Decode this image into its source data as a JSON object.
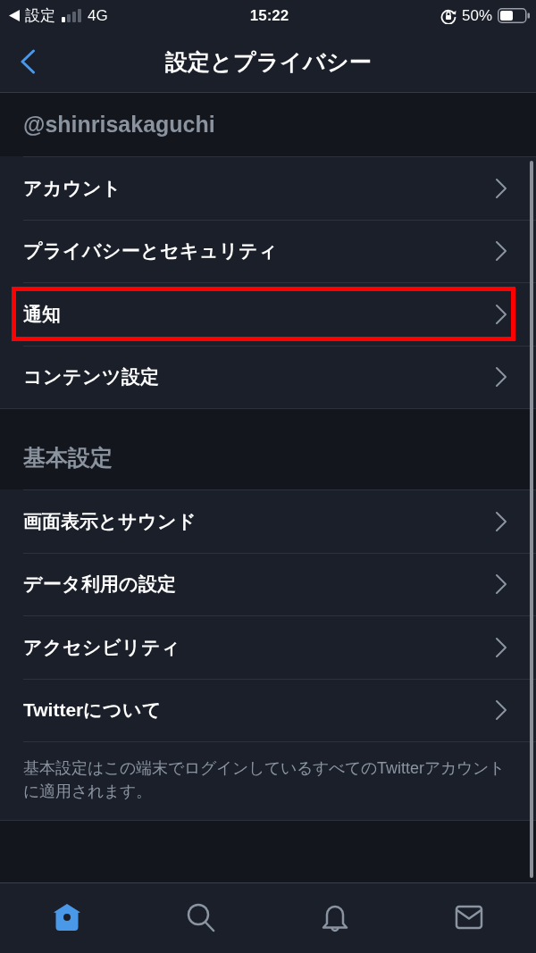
{
  "status_bar": {
    "back_label": "設定",
    "network": "4G",
    "time": "15:22",
    "battery": "50%"
  },
  "nav_bar": {
    "title": "設定とプライバシー"
  },
  "sections": [
    {
      "header": "@shinrisakaguchi",
      "items": [
        {
          "label": "アカウント",
          "highlighted": false
        },
        {
          "label": "プライバシーとセキュリティ",
          "highlighted": false
        },
        {
          "label": "通知",
          "highlighted": true
        },
        {
          "label": "コンテンツ設定",
          "highlighted": false
        }
      ]
    },
    {
      "header": "基本設定",
      "items": [
        {
          "label": "画面表示とサウンド",
          "highlighted": false
        },
        {
          "label": "データ利用の設定",
          "highlighted": false
        },
        {
          "label": "アクセシビリティ",
          "highlighted": false
        },
        {
          "label": "Twitterについて",
          "highlighted": false
        }
      ],
      "note": "基本設定はこの端末でログインしているすべてのTwitterアカウントに適用されます。"
    }
  ],
  "tab_bar": {
    "tabs": [
      {
        "kind": "home",
        "selected": true
      },
      {
        "kind": "search",
        "selected": false
      },
      {
        "kind": "notifications",
        "selected": false
      },
      {
        "kind": "messages",
        "selected": false
      }
    ]
  }
}
